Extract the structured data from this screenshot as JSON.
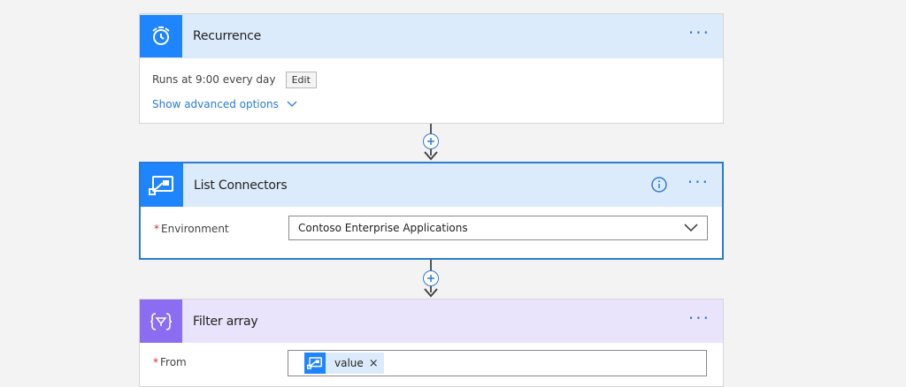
{
  "recurrence": {
    "title": "Recurrence",
    "schedule_text": "Runs at 9:00 every day",
    "edit_label": "Edit",
    "advanced_link": "Show advanced options"
  },
  "list_connectors": {
    "title": "List Connectors",
    "environment_label": "Environment",
    "environment_value": "Contoso Enterprise Applications"
  },
  "filter_array": {
    "title": "Filter array",
    "from_label": "From",
    "token_label": "value",
    "token_remove": "×"
  },
  "more_menu": "···",
  "required_marker": "*",
  "colors": {
    "accent_blue": "#1f85ff",
    "header_blue": "#dcebfb",
    "filter_purple": "#8a6df0",
    "filter_header": "#e9e3fb"
  },
  "icons": [
    "alarm-clock-icon",
    "connector-icon",
    "filter-icon",
    "info-icon",
    "chevron-down-icon",
    "plus-icon"
  ]
}
